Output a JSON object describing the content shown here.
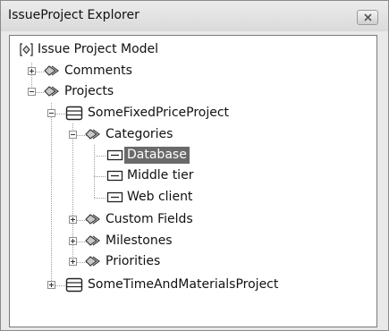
{
  "window": {
    "title": "IssueProject Explorer"
  },
  "icons": {
    "close": "close-icon",
    "model": "model-bracket-icon",
    "folder": "diamond-folder-icon",
    "project": "project-list-icon",
    "item": "item-icon",
    "expander_plus": "plus-box-icon",
    "expander_minus": "minus-box-icon"
  },
  "tree": {
    "root_label": "Issue Project Model",
    "comments_label": "Comments",
    "projects_label": "Projects",
    "project1_label": "SomeFixedPriceProject",
    "categories_label": "Categories",
    "categories": [
      "Database",
      "Middle tier",
      "Web client"
    ],
    "selected_item": "Database",
    "custom_fields_label": "Custom Fields",
    "milestones_label": "Milestones",
    "priorities_label": "Priorities",
    "project2_label": "SomeTimeAndMaterialsProject"
  },
  "colors": {
    "selection": "#6a6a6a",
    "window_bg": "#e9e9e9"
  }
}
